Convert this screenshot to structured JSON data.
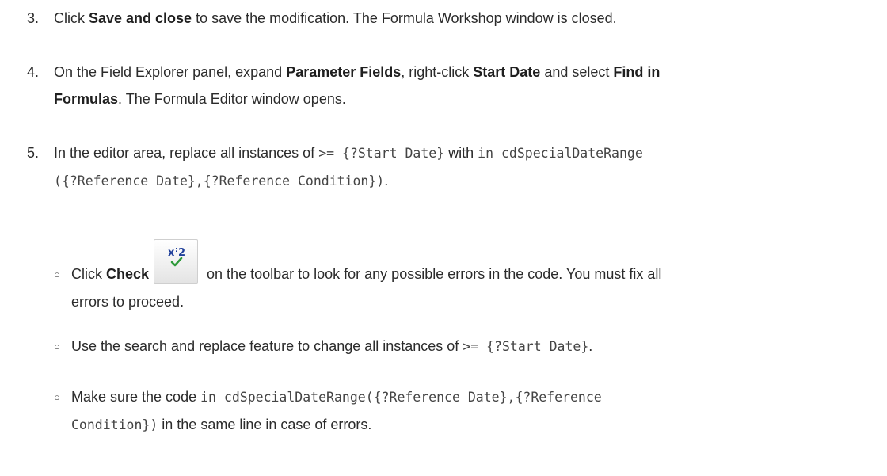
{
  "steps": [
    {
      "number": "3.",
      "pre": "Click ",
      "bold1": "Save and close",
      "post": " to save the modification. The Formula Workshop window is closed."
    },
    {
      "number": "4.",
      "pre": "On the Field Explorer panel, expand ",
      "bold1": "Parameter Fields",
      "mid1": ", right-click ",
      "bold2": "Start Date",
      "mid2": " and select ",
      "bold3": "Find in",
      "bold3b": "Formulas",
      "post": ". The Formula Editor window opens."
    },
    {
      "number": "5.",
      "pre": "In the editor area, replace all instances of ",
      "code1": ">= {?Start Date}",
      "mid1": " with ",
      "code2a": "in cdSpecialDateRange",
      "code2b": "({?Reference Date},{?Reference Condition})",
      "post": "."
    }
  ],
  "subitems": [
    {
      "bullet": "○",
      "pre": "Click ",
      "bold1": "Check",
      "icon": "check-formula-icon",
      "post_line1": " on the toolbar to look for any possible errors in the code. You must fix all",
      "post_line2": "errors to proceed."
    },
    {
      "bullet": "○",
      "pre": "Use the search and replace feature to change all instances of ",
      "code1": ">= {?Start Date}",
      "post": "."
    },
    {
      "bullet": "○",
      "pre": "Make sure the code ",
      "code1a": "in cdSpecialDateRange({?Reference Date},{?Reference",
      "code1b": "Condition})",
      "post": " in the same line in case of errors."
    }
  ],
  "colors": {
    "text": "#2b2b2b",
    "code": "#444444",
    "icon_x": "#1f3f9a",
    "icon_check": "#2e9a3a"
  }
}
